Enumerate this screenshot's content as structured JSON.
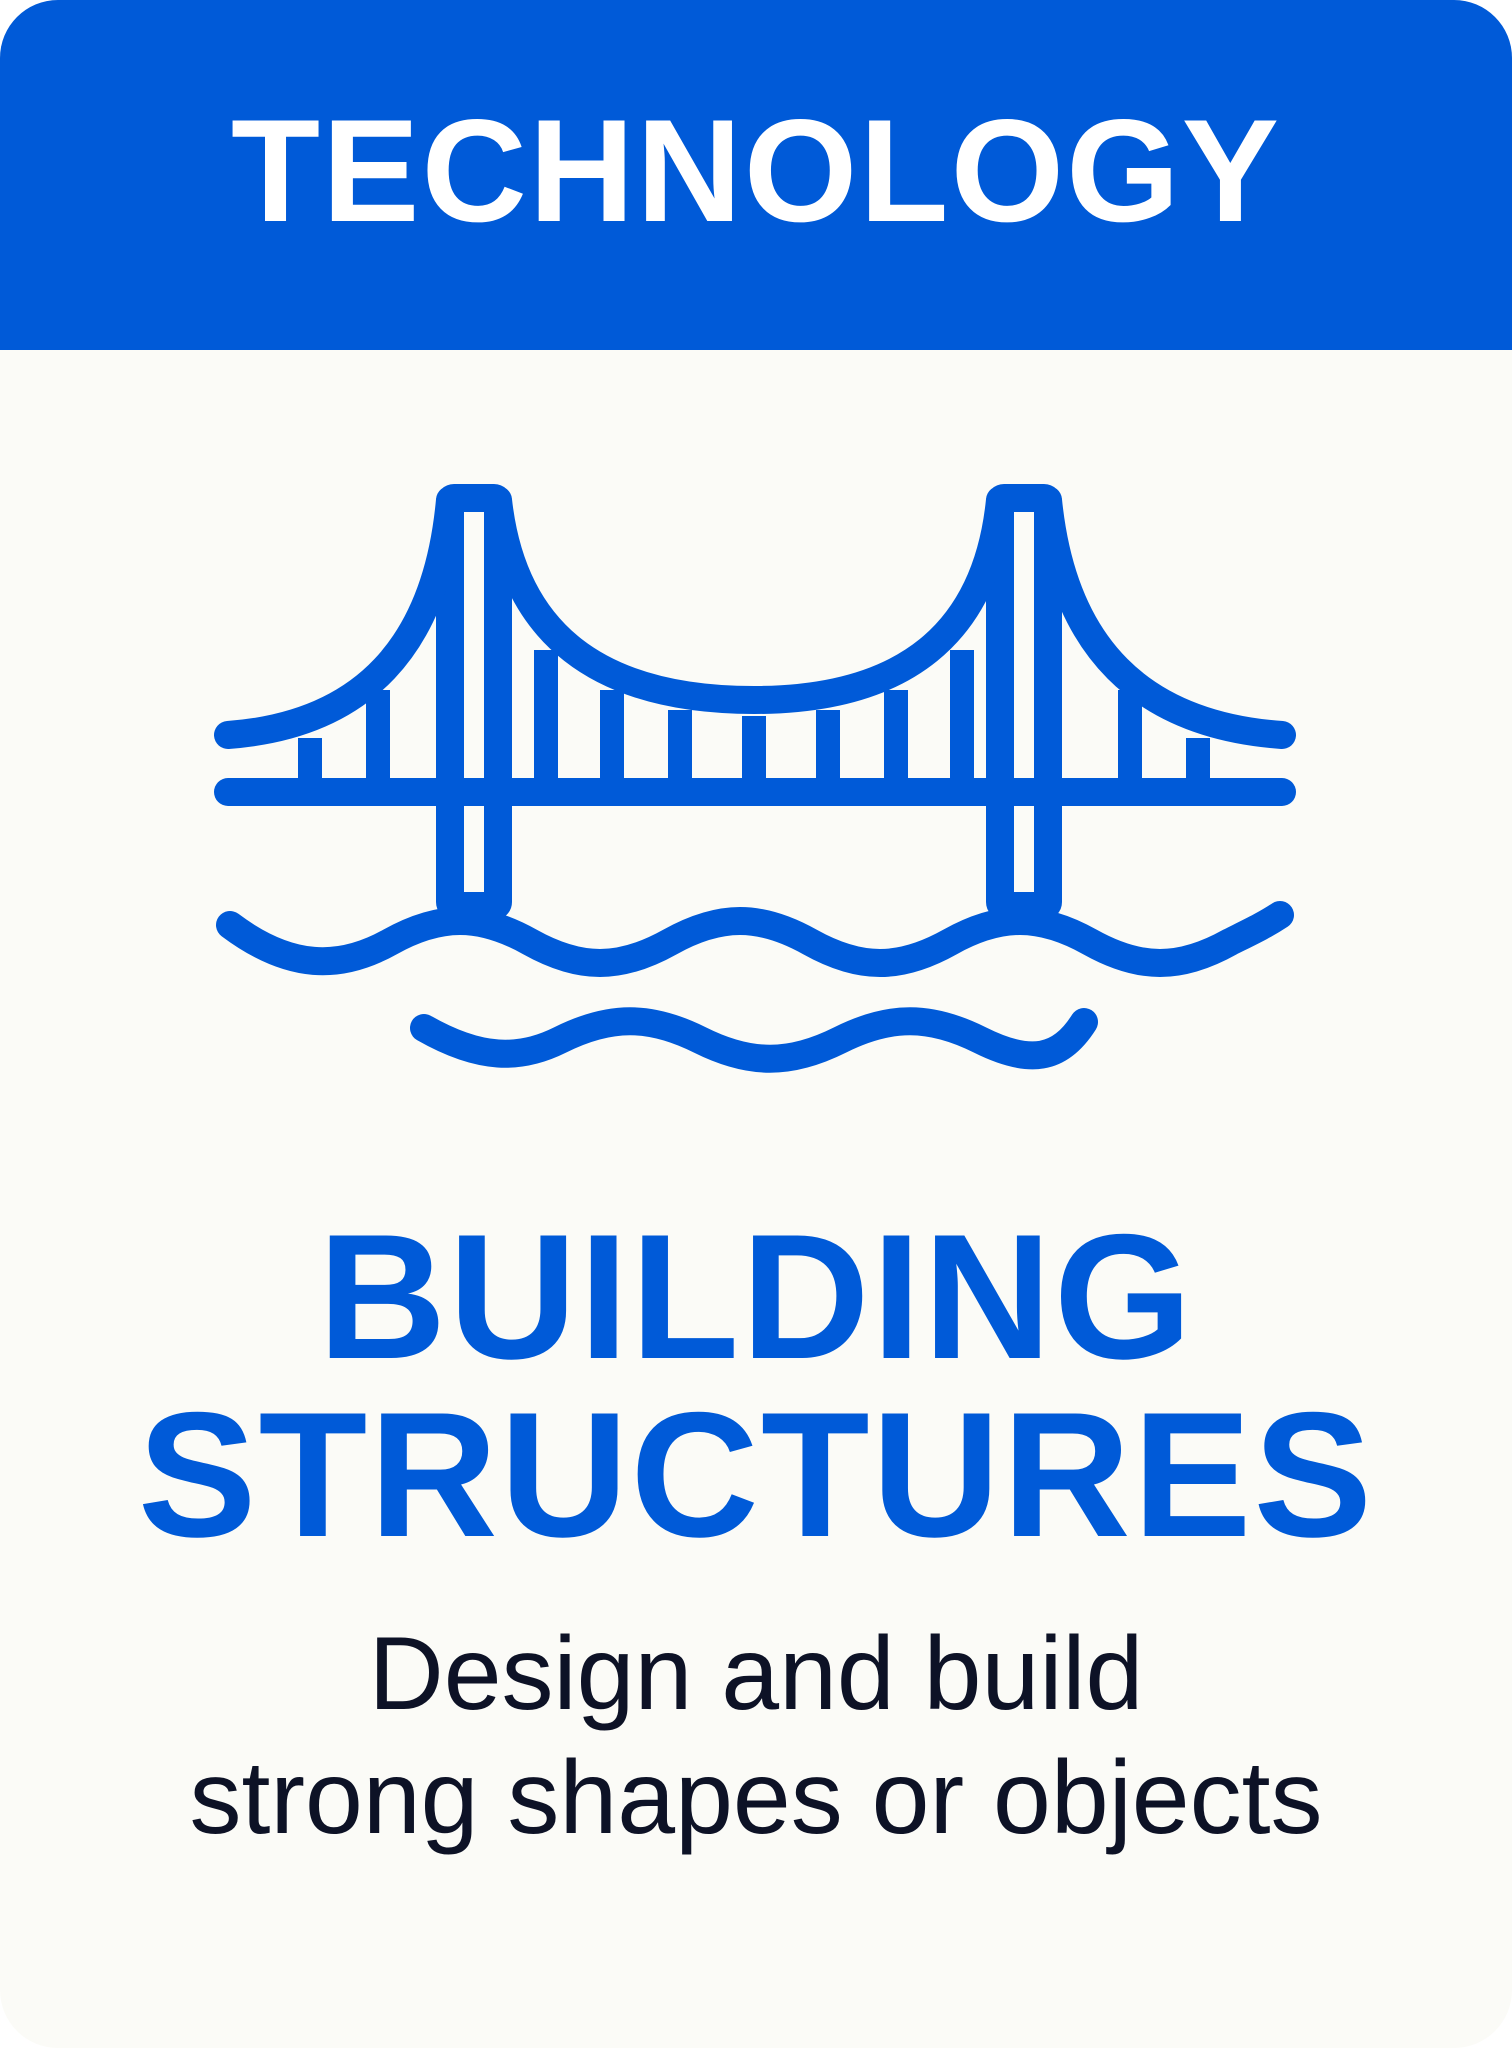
{
  "category": {
    "label": "TECHNOLOGY"
  },
  "illustration": {
    "icon": "suspension-bridge-icon"
  },
  "title": {
    "line1": "BUILDING",
    "line2": "STRUCTURES"
  },
  "subtitle": {
    "line1": "Design and build",
    "line2": "strong shapes or objects"
  },
  "colors": {
    "accent": "#005ad8",
    "card_background": "#fbfbf7",
    "header_text": "#ffffff",
    "body_text": "#0d1226"
  }
}
